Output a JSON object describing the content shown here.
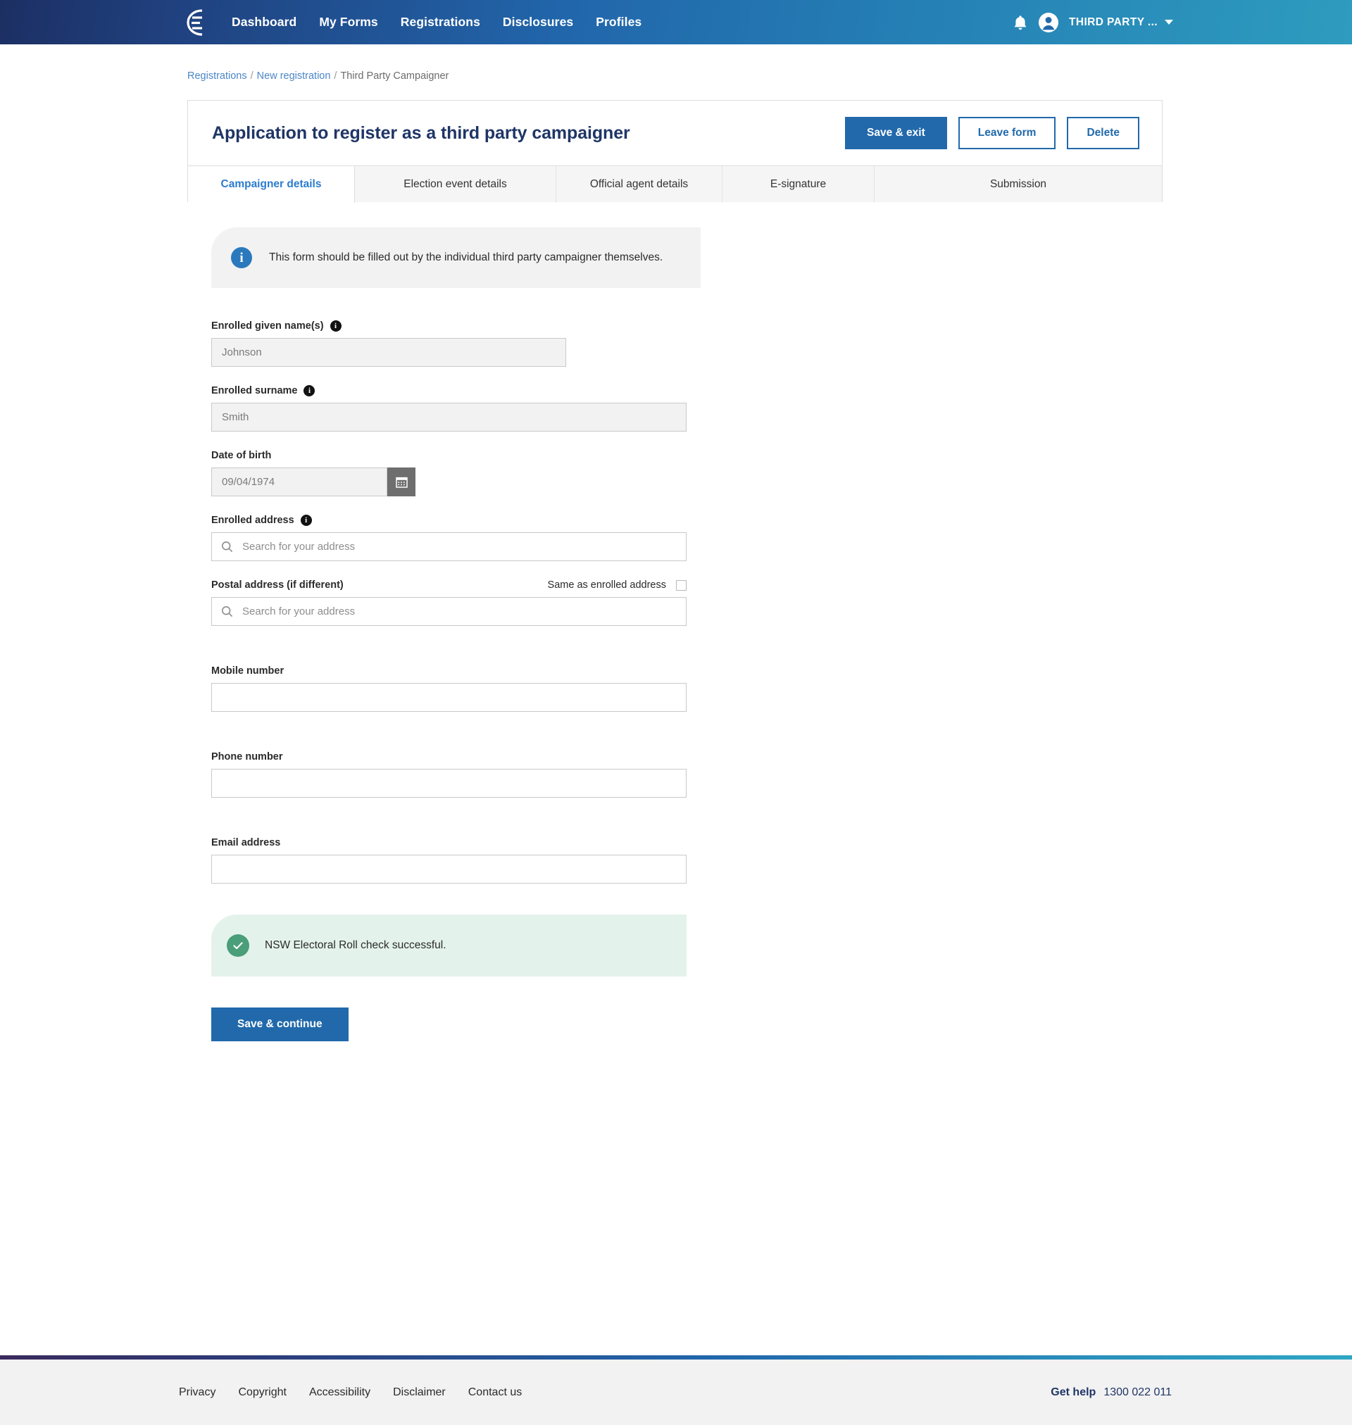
{
  "topnav": {
    "brand_icon": "electoral-commission-logo",
    "links": [
      {
        "label": "Dashboard"
      },
      {
        "label": "My Forms"
      },
      {
        "label": "Registrations"
      },
      {
        "label": "Disclosures"
      },
      {
        "label": "Profiles"
      }
    ],
    "bell_icon": "notification-bell-icon",
    "avatar_icon": "user-avatar-icon",
    "user_name": "THIRD PARTY ...",
    "caret_icon": "chevron-down-icon"
  },
  "breadcrumb": {
    "items": [
      {
        "label": "Registrations",
        "link": true
      },
      {
        "label": "New registration",
        "link": true
      },
      {
        "label": "Third Party Campaigner",
        "link": false
      }
    ],
    "separator": "/"
  },
  "card": {
    "title": "Application to register as a third party campaigner",
    "actions": {
      "save_exit": "Save & exit",
      "leave_form": "Leave form",
      "delete": "Delete"
    }
  },
  "tabs": [
    {
      "label": "Campaigner details",
      "active": true
    },
    {
      "label": "Election event details",
      "active": false
    },
    {
      "label": "Official agent details",
      "active": false
    },
    {
      "label": "E-signature",
      "active": false
    },
    {
      "label": "Submission",
      "active": false
    }
  ],
  "form": {
    "info_banner": {
      "icon": "info-circle-icon",
      "text": "This form should be filled out by the individual third party campaigner themselves."
    },
    "fields": {
      "given_names": {
        "label": "Enrolled given name(s)",
        "tip_icon": "info-tooltip-icon",
        "value": "Johnson"
      },
      "surname": {
        "label": "Enrolled surname",
        "tip_icon": "info-tooltip-icon",
        "value": "Smith"
      },
      "date_of_birth": {
        "label": "Date of birth",
        "value": "09/04/1974",
        "calendar_icon": "calendar-icon"
      },
      "enrolled_address": {
        "label": "Enrolled address",
        "tip_icon": "info-tooltip-icon",
        "placeholder": "Search for your address",
        "search_icon": "search-icon"
      },
      "postal_address": {
        "label": "Postal address (if different)",
        "placeholder": "Search for your address",
        "search_icon": "search-icon",
        "same_as_label": "Same as enrolled address",
        "same_as_checked": false
      },
      "mobile_number": {
        "label": "Mobile number",
        "value": ""
      },
      "phone_number": {
        "label": "Phone number",
        "value": ""
      },
      "email_address": {
        "label": "Email address",
        "value": ""
      }
    },
    "success_banner": {
      "icon": "check-circle-icon",
      "text": "NSW Electoral Roll check successful."
    },
    "save_continue": "Save & continue"
  },
  "footer": {
    "links": [
      {
        "label": "Privacy"
      },
      {
        "label": "Copyright"
      },
      {
        "label": "Accessibility"
      },
      {
        "label": "Disclaimer"
      },
      {
        "label": "Contact us"
      }
    ],
    "help_label": "Get help",
    "help_phone": "1300 022 011"
  },
  "colors": {
    "brand_navy": "#1f3566",
    "brand_blue": "#2169ab",
    "link_blue": "#4a86c8",
    "tab_active": "#2c7ccd",
    "success_green": "#4a9e7a",
    "success_bg": "#e4f2ec",
    "info_bg": "#f2f2f2"
  }
}
